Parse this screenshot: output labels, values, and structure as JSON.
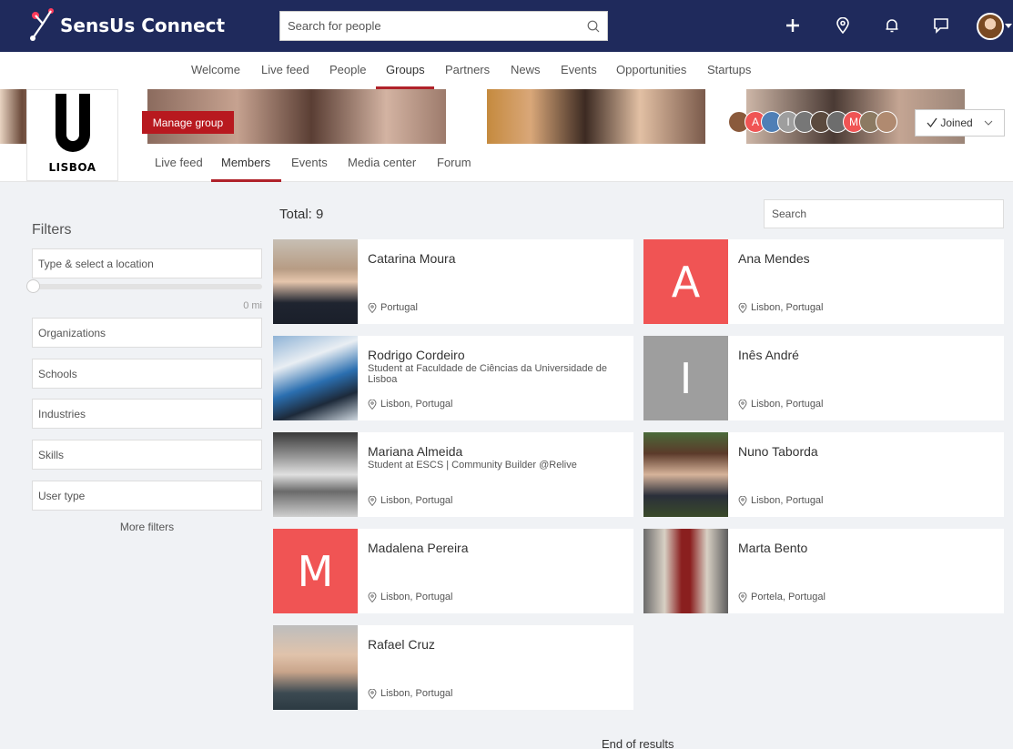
{
  "app": {
    "name": "SensUs Connect"
  },
  "topbar": {
    "search_placeholder": "Search for people",
    "icons": [
      "plus-icon",
      "location-pin-icon",
      "bell-icon",
      "chat-icon",
      "profile-avatar"
    ]
  },
  "nav": {
    "items": [
      "Welcome",
      "Live feed",
      "People",
      "Groups",
      "Partners",
      "News",
      "Events",
      "Opportunities",
      "Startups"
    ],
    "active": "Groups"
  },
  "group": {
    "logo_text": "LISBOA",
    "manage_label": "Manage group",
    "joined_label": "Joined",
    "member_avatar_letters": [
      "A",
      "I",
      "M"
    ],
    "tabs": [
      "Live feed",
      "Members",
      "Events",
      "Media center",
      "Forum"
    ],
    "active_tab": "Members"
  },
  "filters": {
    "title": "Filters",
    "location_placeholder": "Type & select a location",
    "distance_value": "0 mi",
    "fields": [
      "Organizations",
      "Schools",
      "Industries",
      "Skills",
      "User type"
    ],
    "more_label": "More filters"
  },
  "results": {
    "total_label": "Total: 9",
    "search_placeholder": "Search",
    "members": [
      {
        "name": "Catarina Moura",
        "headline": "",
        "location": "Portugal",
        "avatar": "photo"
      },
      {
        "name": "Ana Mendes",
        "headline": "",
        "location": "Lisbon, Portugal",
        "avatar": "A",
        "color": "#f05454"
      },
      {
        "name": "Rodrigo Cordeiro",
        "headline": "Student at Faculdade de Ciências da Universidade de Lisboa",
        "location": "Lisbon, Portugal",
        "avatar": "photo"
      },
      {
        "name": "Inês André",
        "headline": "",
        "location": "Lisbon, Portugal",
        "avatar": "I",
        "color": "#9e9e9e"
      },
      {
        "name": "Mariana Almeida",
        "headline": "Student at ESCS | Community Builder @Relive",
        "location": "Lisbon, Portugal",
        "avatar": "photo"
      },
      {
        "name": "Nuno Taborda",
        "headline": "",
        "location": "Lisbon, Portugal",
        "avatar": "photo"
      },
      {
        "name": "Madalena Pereira",
        "headline": "",
        "location": "Lisbon, Portugal",
        "avatar": "M",
        "color": "#f05454"
      },
      {
        "name": "Marta Bento",
        "headline": "",
        "location": "Portela, Portugal",
        "avatar": "photo"
      },
      {
        "name": "Rafael Cruz",
        "headline": "",
        "location": "Lisbon, Portugal",
        "avatar": "photo"
      }
    ],
    "end_label": "End of results"
  },
  "colors": {
    "topbar": "#1f2a5c",
    "accent": "#b0222a",
    "manage_button": "#b8191f",
    "letter_avatar_red": "#f05454",
    "letter_avatar_gray": "#9e9e9e"
  }
}
